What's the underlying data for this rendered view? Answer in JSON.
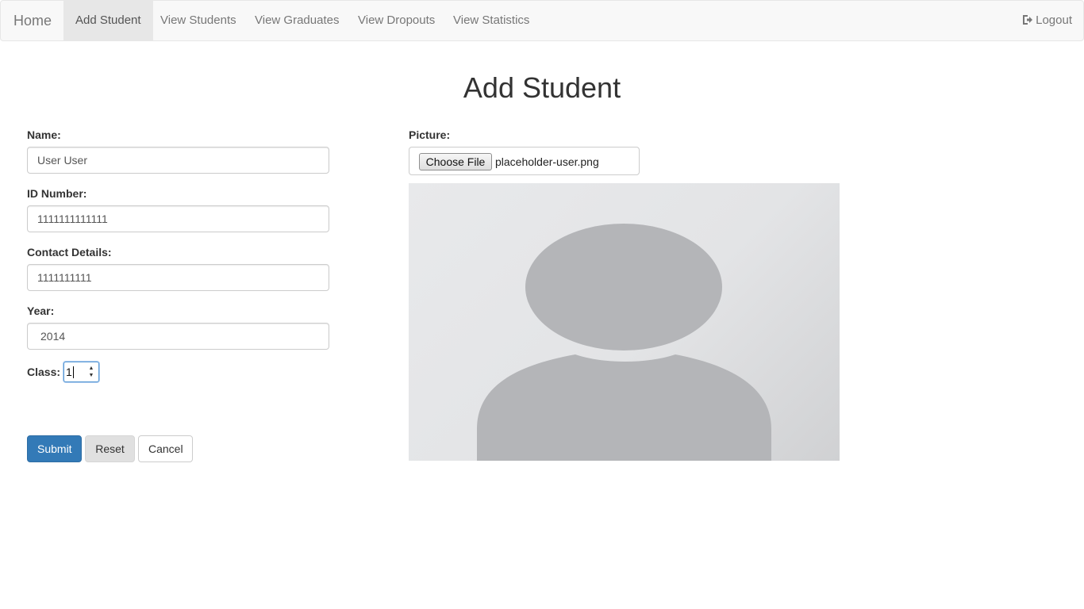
{
  "navbar": {
    "brand": "Home",
    "items": [
      {
        "label": "Add Student",
        "active": true
      },
      {
        "label": "View Students"
      },
      {
        "label": "View Graduates"
      },
      {
        "label": "View Dropouts"
      },
      {
        "label": "View Statistics"
      }
    ],
    "logout": "Logout",
    "logout_icon": "logout-icon"
  },
  "page": {
    "title": "Add Student"
  },
  "form": {
    "name": {
      "label": "Name:",
      "value": "User User"
    },
    "id_number": {
      "label": "ID Number:",
      "value": "1111111111111"
    },
    "contact": {
      "label": "Contact Details:",
      "value": "1111111111"
    },
    "year": {
      "label": "Year:",
      "value": "2014"
    },
    "class": {
      "label": "Class:",
      "value": "1"
    },
    "picture": {
      "label": "Picture:",
      "choose_button": "Choose File",
      "file_name": "placeholder-user.png"
    }
  },
  "buttons": {
    "submit": "Submit",
    "reset": "Reset",
    "cancel": "Cancel"
  },
  "colors": {
    "primary": "#337ab7",
    "navbar_bg": "#f8f8f8",
    "active_nav_bg": "#e7e7e7",
    "placeholder_silhouette": "#b4b5b8"
  }
}
